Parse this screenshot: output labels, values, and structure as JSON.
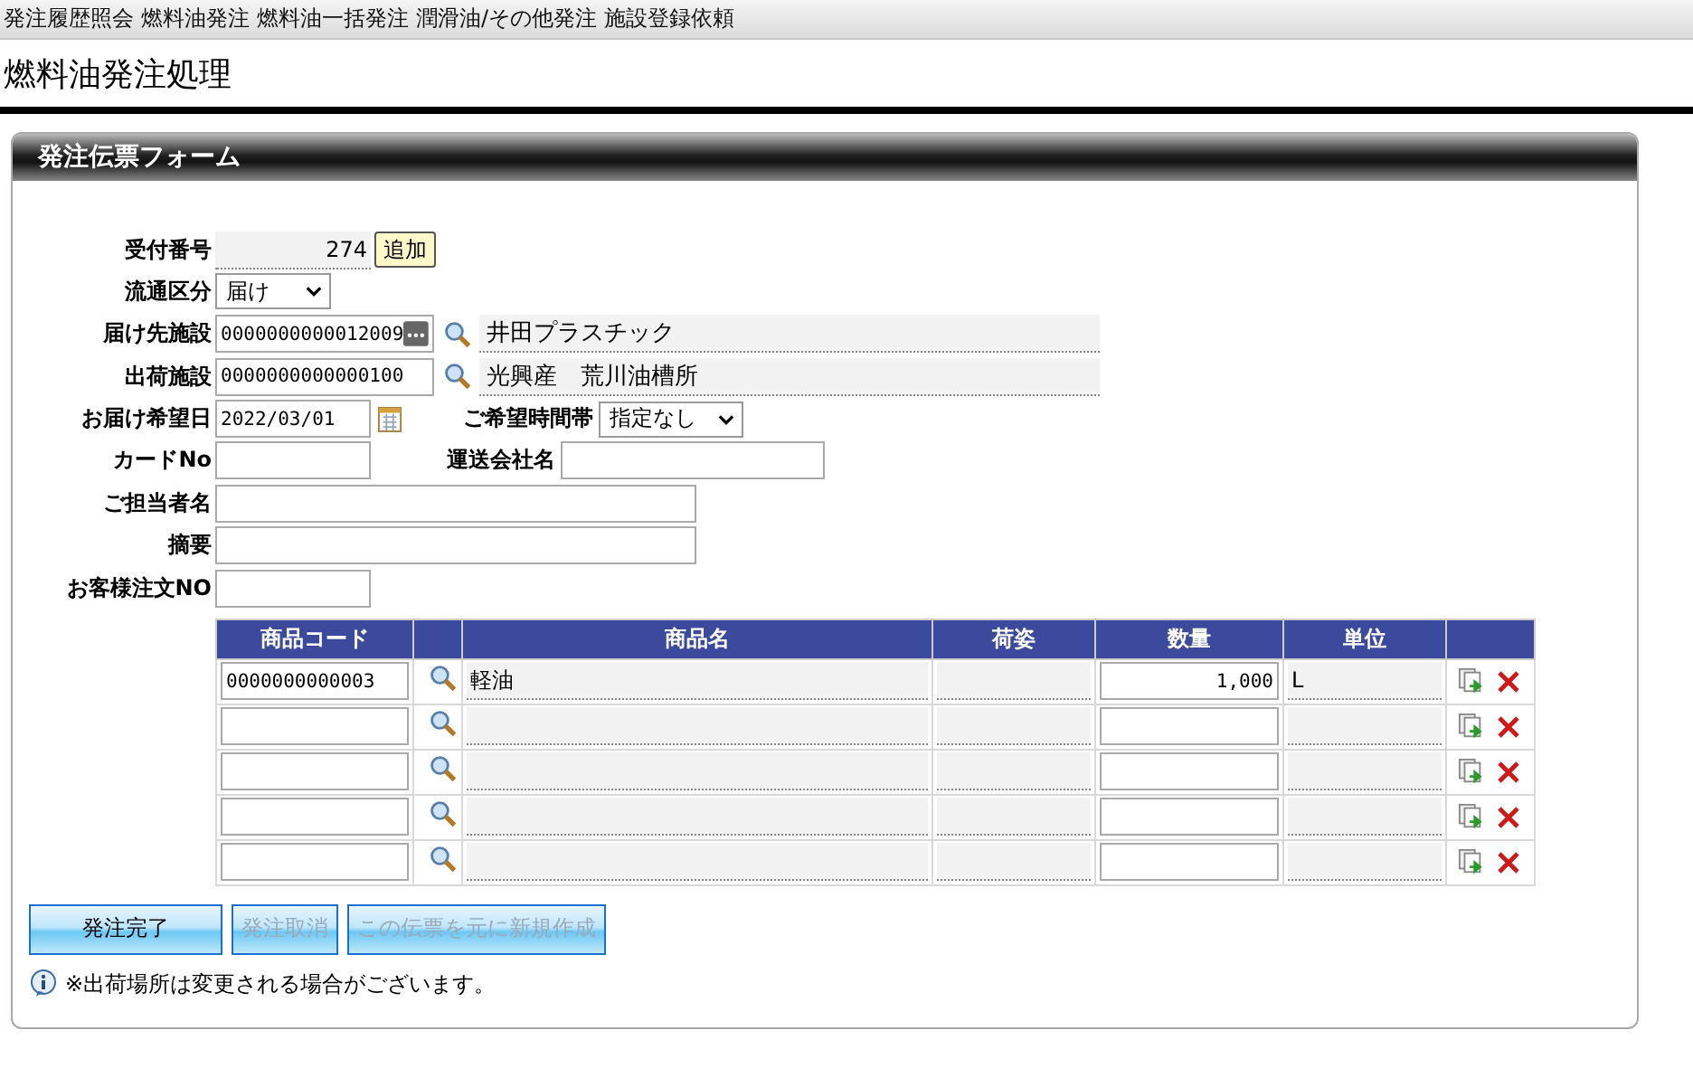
{
  "nav": {
    "items": [
      "発注履歴照会",
      "燃料油発注",
      "燃料油一括発注",
      "潤滑油/その他発注",
      "施設登録依頼"
    ]
  },
  "page_title": "燃料油発注処理",
  "form": {
    "title": "発注伝票フォーム",
    "receipt": {
      "label": "受付番号",
      "value": "274",
      "button": "追加"
    },
    "distribution": {
      "label": "流通区分",
      "value": "届け"
    },
    "destination": {
      "label": "届け先施設",
      "code": "0000000000012009",
      "name": "井田プラスチック"
    },
    "shipping": {
      "label": "出荷施設",
      "code": "0000000000000100",
      "name": "光興産　荒川油槽所"
    },
    "delivery_date": {
      "label": "お届け希望日",
      "value": "2022/03/01"
    },
    "time_slot": {
      "label": "ご希望時間帯",
      "value": "指定なし"
    },
    "card_no": {
      "label": "カードNo"
    },
    "carrier": {
      "label": "運送会社名"
    },
    "person": {
      "label": "ご担当者名"
    },
    "remarks": {
      "label": "摘要"
    },
    "customer_order": {
      "label": "お客様注文NO"
    }
  },
  "table": {
    "columns": [
      "商品コード",
      "商品名",
      "荷姿",
      "数量",
      "単位"
    ],
    "rows": [
      {
        "code": "0000000000003",
        "name": "軽油",
        "quantity": "1,000",
        "unit": "L"
      },
      {},
      {},
      {},
      {}
    ]
  },
  "buttons": [
    {
      "label": "発注完了",
      "disabled": false
    },
    {
      "label": "発注取消",
      "disabled": true
    },
    {
      "label": "この伝票を元に新規作成",
      "disabled": true
    }
  ],
  "note": "※出荷場所は変更される場合がございます。"
}
